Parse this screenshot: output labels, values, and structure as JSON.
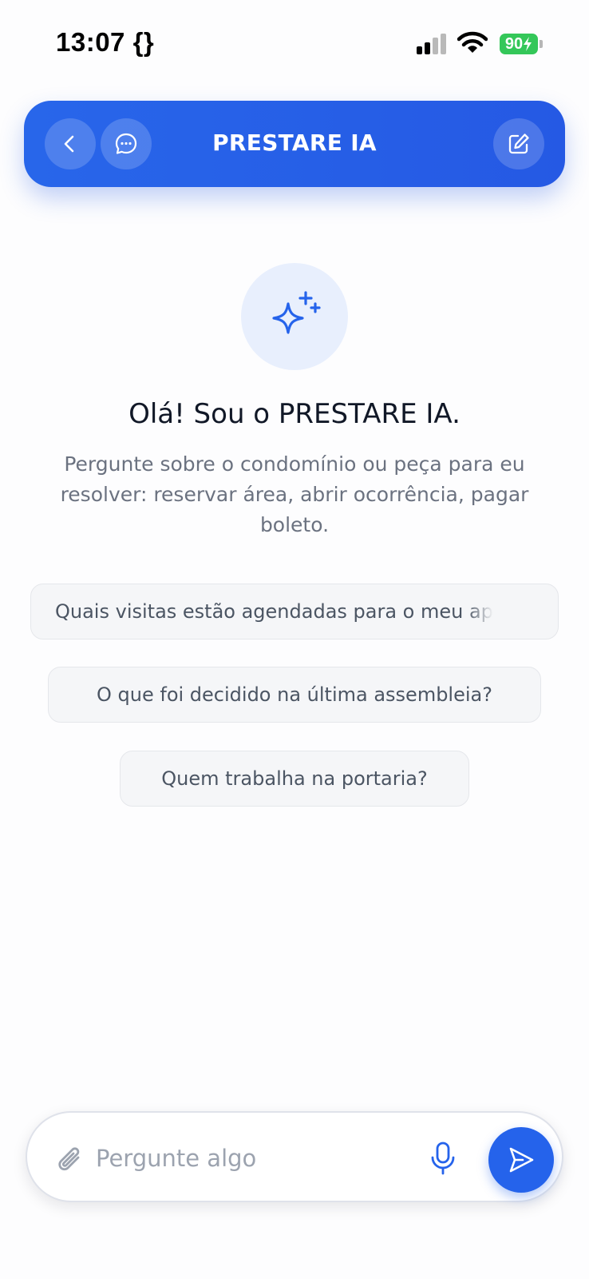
{
  "status_bar": {
    "time": "13:07 {}",
    "battery": "90"
  },
  "header": {
    "title": "PRESTARE IA",
    "back_icon": "chevron-left-icon",
    "chats_icon": "chat-bubble-icon",
    "new_chat_icon": "edit-icon"
  },
  "hero": {
    "icon": "sparkles-icon",
    "greeting": "Olá! Sou o PRESTARE IA.",
    "subtitle": "Pergunte sobre o condomínio ou peça para eu resolver: reservar área, abrir ocorrência, pagar boleto."
  },
  "suggestions": [
    {
      "label": "Quais visitas estão agendadas para o meu ap"
    },
    {
      "label": "O que foi decidido na última assembleia?"
    },
    {
      "label": "Quem trabalha na portaria?"
    }
  ],
  "composer": {
    "placeholder": "Pergunte algo",
    "attach_icon": "paperclip-icon",
    "mic_icon": "microphone-icon",
    "send_icon": "send-icon"
  },
  "colors": {
    "primary": "#2563eb",
    "header": "#2866ea",
    "battery": "#34c759",
    "muted_text": "#6b7280"
  }
}
